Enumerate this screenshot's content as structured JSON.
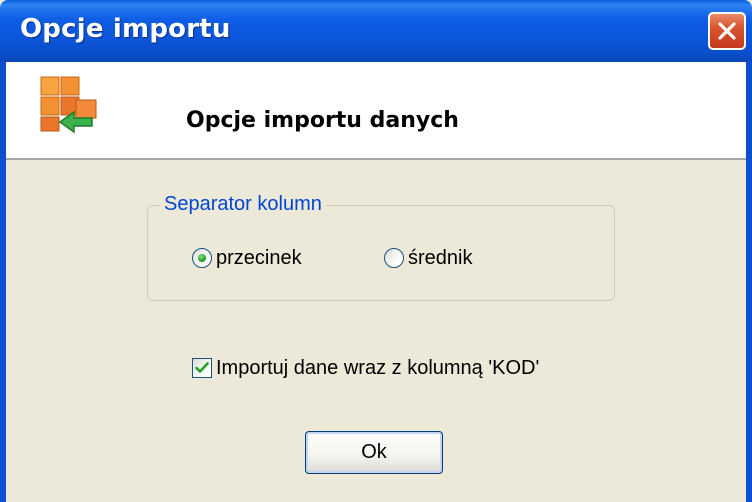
{
  "window": {
    "title": "Opcje importu",
    "close_icon": "close-icon"
  },
  "header": {
    "icon": "import-grid-icon",
    "title": "Opcje importu danych"
  },
  "separator_group": {
    "legend": "Separator kolumn",
    "options": [
      {
        "label": "przecinek",
        "selected": true
      },
      {
        "label": "średnik",
        "selected": false
      }
    ]
  },
  "import_kod": {
    "label": "Importuj dane wraz z kolumną 'KOD'",
    "checked": true
  },
  "ok_button": {
    "label": "Ok"
  },
  "colors": {
    "titlebar": "#0a56da",
    "dialog_bg": "#ece9d8",
    "legend_text": "#0046d5",
    "radio_dot": "#21a121",
    "check_mark": "#21a121"
  }
}
